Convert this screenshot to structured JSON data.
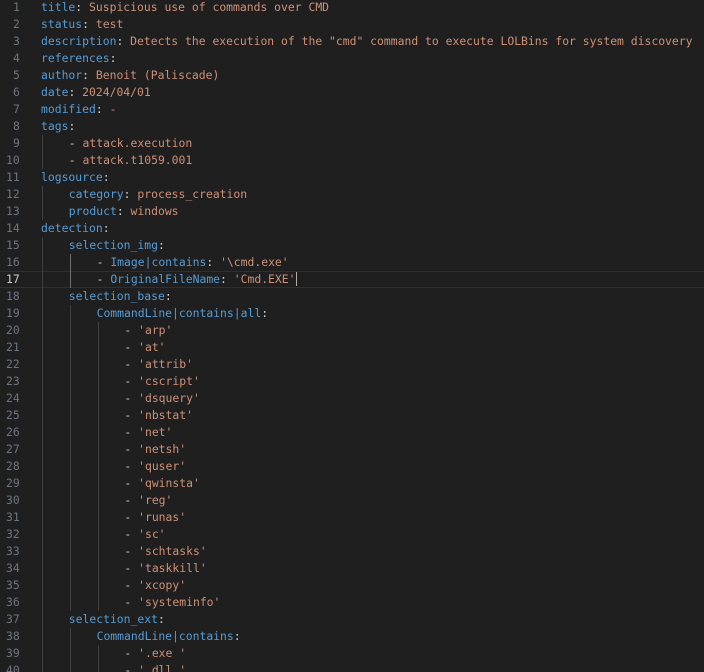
{
  "editor": {
    "language": "yaml",
    "current_line": 17,
    "colors": {
      "background": "#1f1f1f",
      "key": "#569cd6",
      "string": "#ce9178",
      "punctuation": "#cccccc",
      "line_number": "#6e7681",
      "line_number_active": "#cccccc"
    },
    "lines": [
      {
        "n": "1",
        "indent": 0,
        "tokens": [
          [
            "k",
            "title"
          ],
          [
            "p",
            ": "
          ],
          [
            "s",
            "Suspicious use of commands over CMD"
          ]
        ]
      },
      {
        "n": "2",
        "indent": 0,
        "tokens": [
          [
            "k",
            "status"
          ],
          [
            "p",
            ": "
          ],
          [
            "s",
            "test"
          ]
        ]
      },
      {
        "n": "3",
        "indent": 0,
        "tokens": [
          [
            "k",
            "description"
          ],
          [
            "p",
            ": "
          ],
          [
            "s",
            "Detects the execution of the \"cmd\" command to execute LOLBins for system discovery"
          ]
        ]
      },
      {
        "n": "4",
        "indent": 0,
        "tokens": [
          [
            "k",
            "references"
          ],
          [
            "p",
            ":"
          ]
        ]
      },
      {
        "n": "5",
        "indent": 0,
        "tokens": [
          [
            "k",
            "author"
          ],
          [
            "p",
            ": "
          ],
          [
            "s",
            "Benoit (Paliscade)"
          ]
        ]
      },
      {
        "n": "6",
        "indent": 0,
        "tokens": [
          [
            "k",
            "date"
          ],
          [
            "p",
            ": "
          ],
          [
            "s",
            "2024/04/01"
          ]
        ]
      },
      {
        "n": "7",
        "indent": 0,
        "tokens": [
          [
            "k",
            "modified"
          ],
          [
            "p",
            ": "
          ],
          [
            "s",
            "-"
          ]
        ]
      },
      {
        "n": "8",
        "indent": 0,
        "tokens": [
          [
            "k",
            "tags"
          ],
          [
            "p",
            ":"
          ]
        ]
      },
      {
        "n": "9",
        "indent": 1,
        "tokens": [
          [
            "p",
            "- "
          ],
          [
            "s",
            "attack.execution"
          ]
        ]
      },
      {
        "n": "10",
        "indent": 1,
        "tokens": [
          [
            "p",
            "- "
          ],
          [
            "s",
            "attack.t1059.001"
          ]
        ]
      },
      {
        "n": "11",
        "indent": 0,
        "tokens": [
          [
            "k",
            "logsource"
          ],
          [
            "p",
            ":"
          ]
        ]
      },
      {
        "n": "12",
        "indent": 1,
        "tokens": [
          [
            "k",
            "category"
          ],
          [
            "p",
            ": "
          ],
          [
            "s",
            "process_creation"
          ]
        ]
      },
      {
        "n": "13",
        "indent": 1,
        "tokens": [
          [
            "k",
            "product"
          ],
          [
            "p",
            ": "
          ],
          [
            "s",
            "windows"
          ]
        ]
      },
      {
        "n": "14",
        "indent": 0,
        "tokens": [
          [
            "k",
            "detection"
          ],
          [
            "p",
            ":"
          ]
        ]
      },
      {
        "n": "15",
        "indent": 1,
        "tokens": [
          [
            "k",
            "selection_img"
          ],
          [
            "p",
            ":"
          ]
        ]
      },
      {
        "n": "16",
        "indent": 2,
        "tokens": [
          [
            "p",
            "- "
          ],
          [
            "k",
            "Image"
          ],
          [
            "pipe",
            "|"
          ],
          [
            "k",
            "contains"
          ],
          [
            "p",
            ": "
          ],
          [
            "s",
            "'\\cmd.exe'"
          ]
        ]
      },
      {
        "n": "17",
        "indent": 2,
        "tokens": [
          [
            "p",
            "- "
          ],
          [
            "k",
            "OriginalFileName"
          ],
          [
            "p",
            ": "
          ],
          [
            "s",
            "'Cmd.EXE'"
          ]
        ],
        "cursor": true
      },
      {
        "n": "18",
        "indent": 1,
        "tokens": [
          [
            "k",
            "selection_base"
          ],
          [
            "p",
            ":"
          ]
        ]
      },
      {
        "n": "19",
        "indent": 2,
        "tokens": [
          [
            "k",
            "CommandLine"
          ],
          [
            "pipe",
            "|"
          ],
          [
            "k",
            "contains"
          ],
          [
            "pipe",
            "|"
          ],
          [
            "k",
            "all"
          ],
          [
            "p",
            ":"
          ]
        ]
      },
      {
        "n": "20",
        "indent": 3,
        "tokens": [
          [
            "p",
            "- "
          ],
          [
            "s",
            "'arp'"
          ]
        ]
      },
      {
        "n": "21",
        "indent": 3,
        "tokens": [
          [
            "p",
            "- "
          ],
          [
            "s",
            "'at'"
          ]
        ]
      },
      {
        "n": "22",
        "indent": 3,
        "tokens": [
          [
            "p",
            "- "
          ],
          [
            "s",
            "'attrib'"
          ]
        ]
      },
      {
        "n": "23",
        "indent": 3,
        "tokens": [
          [
            "p",
            "- "
          ],
          [
            "s",
            "'cscript'"
          ]
        ]
      },
      {
        "n": "24",
        "indent": 3,
        "tokens": [
          [
            "p",
            "- "
          ],
          [
            "s",
            "'dsquery'"
          ]
        ]
      },
      {
        "n": "25",
        "indent": 3,
        "tokens": [
          [
            "p",
            "- "
          ],
          [
            "s",
            "'nbstat'"
          ]
        ]
      },
      {
        "n": "26",
        "indent": 3,
        "tokens": [
          [
            "p",
            "- "
          ],
          [
            "s",
            "'net'"
          ]
        ]
      },
      {
        "n": "27",
        "indent": 3,
        "tokens": [
          [
            "p",
            "- "
          ],
          [
            "s",
            "'netsh'"
          ]
        ]
      },
      {
        "n": "28",
        "indent": 3,
        "tokens": [
          [
            "p",
            "- "
          ],
          [
            "s",
            "'quser'"
          ]
        ]
      },
      {
        "n": "29",
        "indent": 3,
        "tokens": [
          [
            "p",
            "- "
          ],
          [
            "s",
            "'qwinsta'"
          ]
        ]
      },
      {
        "n": "30",
        "indent": 3,
        "tokens": [
          [
            "p",
            "- "
          ],
          [
            "s",
            "'reg'"
          ]
        ]
      },
      {
        "n": "31",
        "indent": 3,
        "tokens": [
          [
            "p",
            "- "
          ],
          [
            "s",
            "'runas'"
          ]
        ]
      },
      {
        "n": "32",
        "indent": 3,
        "tokens": [
          [
            "p",
            "- "
          ],
          [
            "s",
            "'sc'"
          ]
        ]
      },
      {
        "n": "33",
        "indent": 3,
        "tokens": [
          [
            "p",
            "- "
          ],
          [
            "s",
            "'schtasks'"
          ]
        ]
      },
      {
        "n": "34",
        "indent": 3,
        "tokens": [
          [
            "p",
            "- "
          ],
          [
            "s",
            "'taskkill'"
          ]
        ]
      },
      {
        "n": "35",
        "indent": 3,
        "tokens": [
          [
            "p",
            "- "
          ],
          [
            "s",
            "'xcopy'"
          ]
        ]
      },
      {
        "n": "36",
        "indent": 3,
        "tokens": [
          [
            "p",
            "- "
          ],
          [
            "s",
            "'systeminfo'"
          ]
        ]
      },
      {
        "n": "37",
        "indent": 1,
        "tokens": [
          [
            "k",
            "selection_ext"
          ],
          [
            "p",
            ":"
          ]
        ]
      },
      {
        "n": "38",
        "indent": 2,
        "tokens": [
          [
            "k",
            "CommandLine"
          ],
          [
            "pipe",
            "|"
          ],
          [
            "k",
            "contains"
          ],
          [
            "p",
            ":"
          ]
        ]
      },
      {
        "n": "39",
        "indent": 3,
        "tokens": [
          [
            "p",
            "- "
          ],
          [
            "s",
            "'.exe '"
          ]
        ]
      },
      {
        "n": "40",
        "indent": 3,
        "tokens": [
          [
            "p",
            "- "
          ],
          [
            "s",
            "'.dll '"
          ]
        ]
      }
    ]
  }
}
